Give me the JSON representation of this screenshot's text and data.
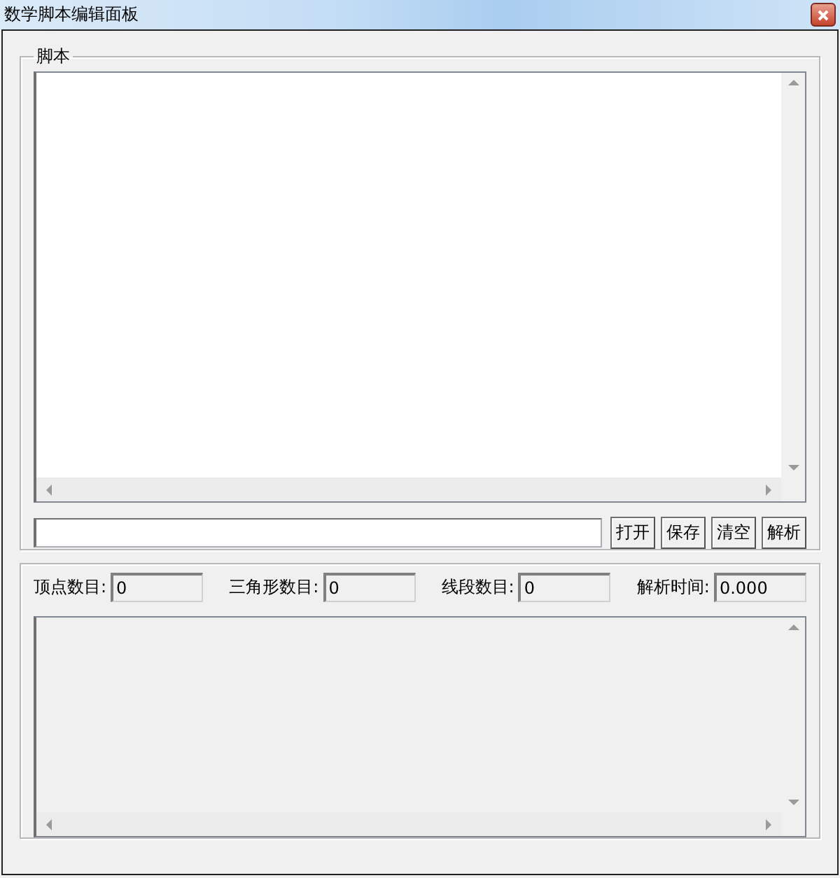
{
  "window": {
    "title": "数学脚本编辑面板"
  },
  "script_group": {
    "title": "脚本"
  },
  "buttons": [
    "打开",
    "保存",
    "清空",
    "解析"
  ],
  "stats": [
    {
      "label": "顶点数目:",
      "value": "0"
    },
    {
      "label": "三角形数目:",
      "value": "0"
    },
    {
      "label": "线段数目:",
      "value": "0"
    },
    {
      "label": "解析时间:",
      "value": "0.000"
    }
  ]
}
